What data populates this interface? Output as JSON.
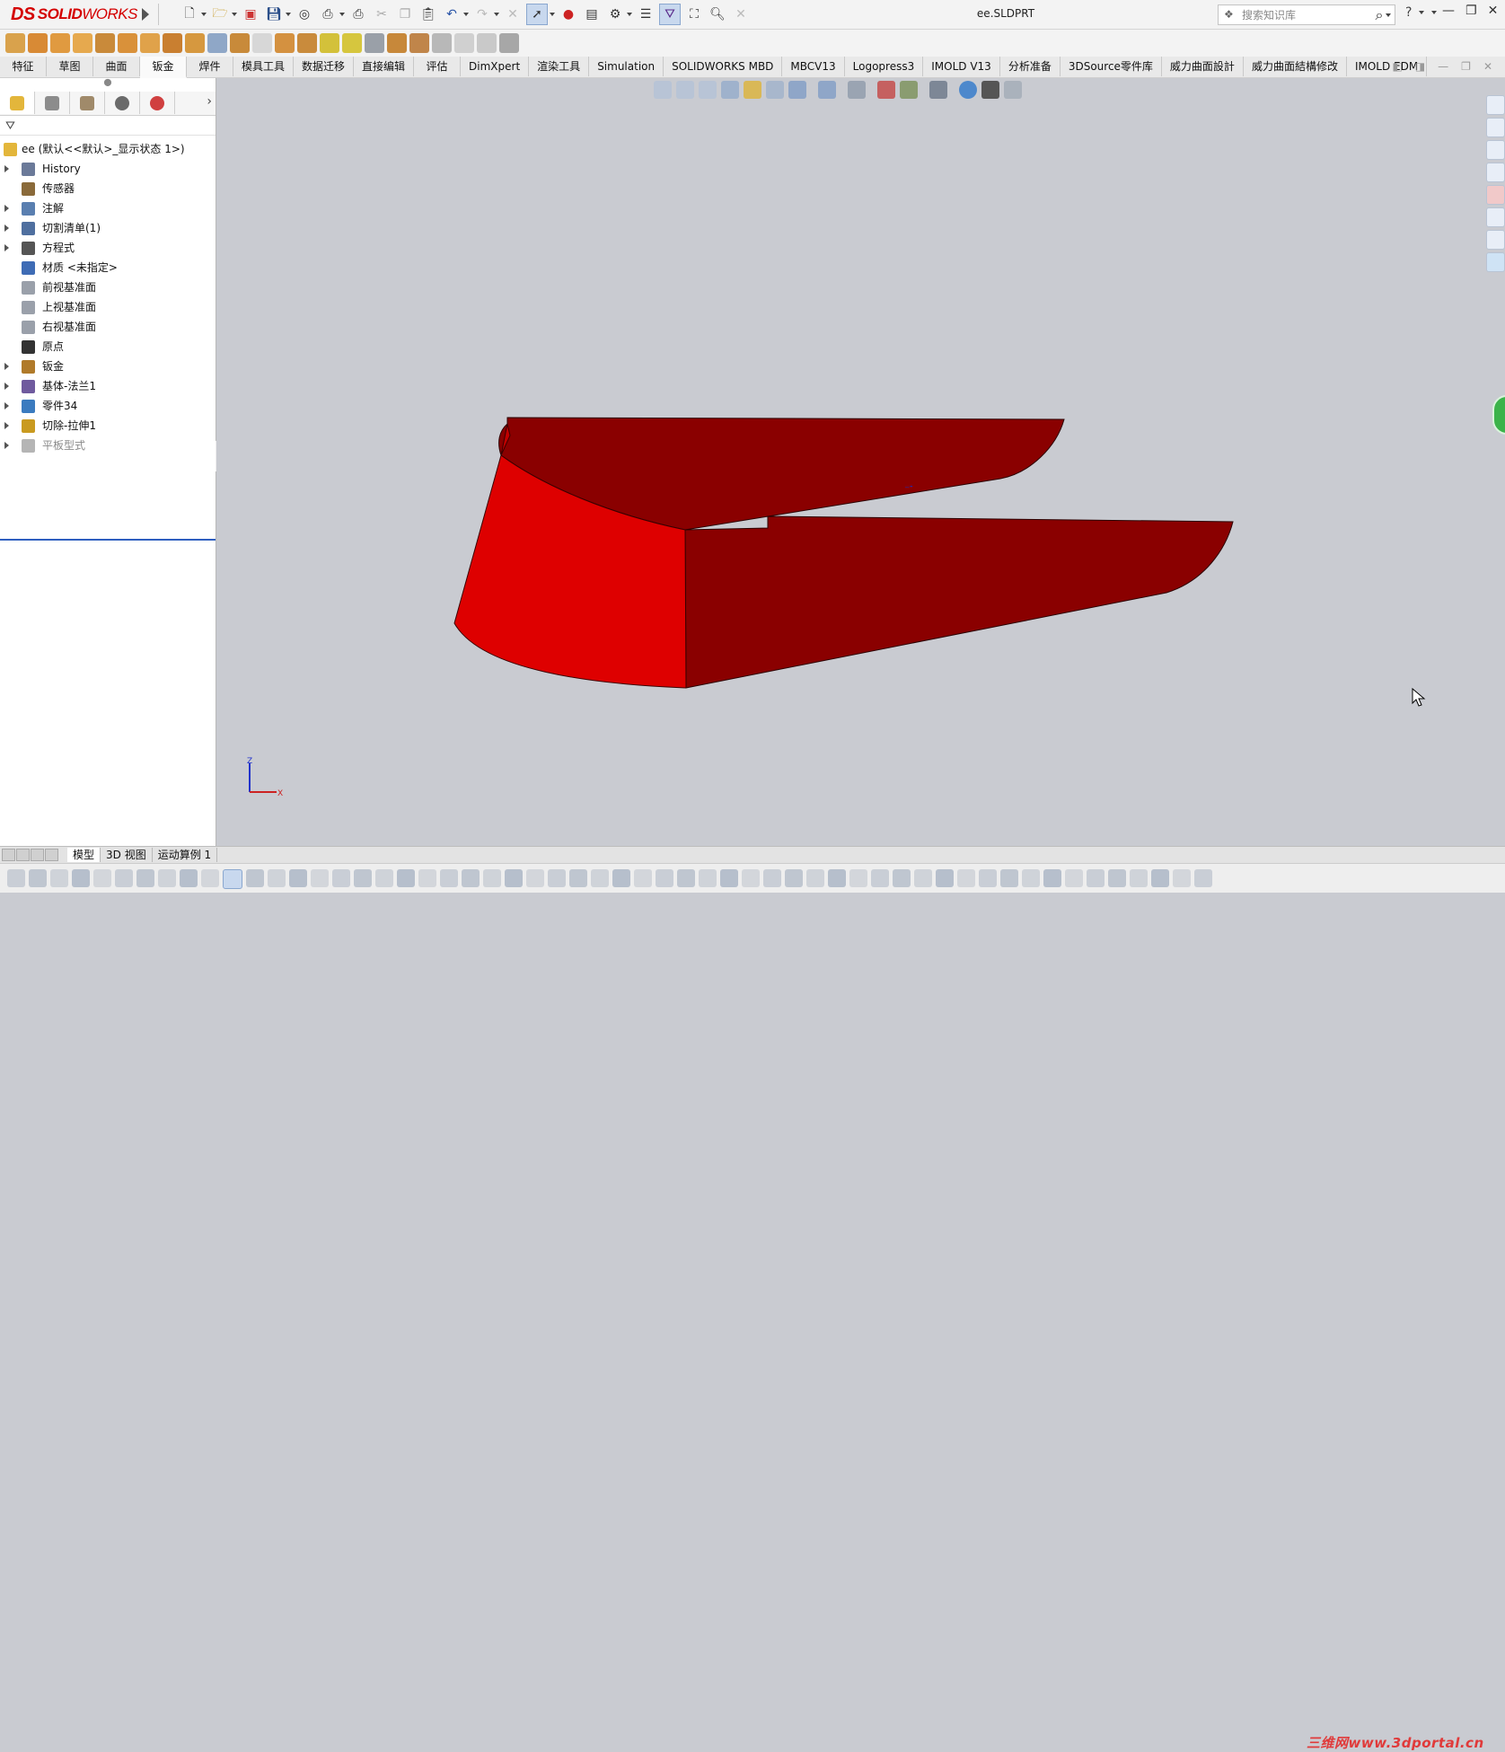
{
  "app": {
    "logo_text_1": "SOLID",
    "logo_text_2": "WORKS",
    "document_title": "ee.SLDPRT"
  },
  "search": {
    "placeholder": "搜索知识库"
  },
  "help": {
    "label": "?"
  },
  "tabs": [
    {
      "label": "特征",
      "active": false
    },
    {
      "label": "草图",
      "active": false
    },
    {
      "label": "曲面",
      "active": false
    },
    {
      "label": "钣金",
      "active": true
    },
    {
      "label": "焊件",
      "active": false
    },
    {
      "label": "模具工具",
      "active": false
    },
    {
      "label": "数据迁移",
      "active": false
    },
    {
      "label": "直接编辑",
      "active": false
    },
    {
      "label": "评估",
      "active": false
    },
    {
      "label": "DimXpert",
      "active": false
    },
    {
      "label": "渲染工具",
      "active": false
    },
    {
      "label": "Simulation",
      "active": false
    },
    {
      "label": "SOLIDWORKS MBD",
      "active": false
    },
    {
      "label": "MBCV13",
      "active": false
    },
    {
      "label": "Logopress3",
      "active": false
    },
    {
      "label": "IMOLD V13",
      "active": false
    },
    {
      "label": "分析准备",
      "active": false
    },
    {
      "label": "3DSource零件库",
      "active": false
    },
    {
      "label": "威力曲面設計",
      "active": false
    },
    {
      "label": "威力曲面結構修改",
      "active": false
    },
    {
      "label": "IMOLD EDM",
      "active": false
    }
  ],
  "tree": {
    "root": "ee  (默认<<默认>_显示状态 1>)",
    "items": [
      {
        "label": "History",
        "expandable": true,
        "icon": "history-icon",
        "color": "#6b7a99"
      },
      {
        "label": "传感器",
        "expandable": false,
        "icon": "sensor-icon",
        "color": "#8a6a3a"
      },
      {
        "label": "注解",
        "expandable": true,
        "icon": "annotation-icon",
        "color": "#5a7fb0"
      },
      {
        "label": "切割清单(1)",
        "expandable": true,
        "icon": "cutlist-icon",
        "color": "#4f6f9f"
      },
      {
        "label": "方程式",
        "expandable": true,
        "icon": "equation-icon",
        "color": "#555555"
      },
      {
        "label": "材质 <未指定>",
        "expandable": false,
        "icon": "material-icon",
        "color": "#3f6cb5"
      },
      {
        "label": "前视基准面",
        "expandable": false,
        "icon": "plane-icon",
        "color": "#9aa0aa"
      },
      {
        "label": "上视基准面",
        "expandable": false,
        "icon": "plane-icon",
        "color": "#9aa0aa"
      },
      {
        "label": "右视基准面",
        "expandable": false,
        "icon": "plane-icon",
        "color": "#9aa0aa"
      },
      {
        "label": "原点",
        "expandable": false,
        "icon": "origin-icon",
        "color": "#333333"
      },
      {
        "label": "钣金",
        "expandable": true,
        "icon": "sheetmetal-icon",
        "color": "#b07a2a"
      },
      {
        "label": "基体-法兰1",
        "expandable": true,
        "icon": "base-flange-icon",
        "color": "#6f5a9e"
      },
      {
        "label": "零件34",
        "expandable": true,
        "icon": "part-icon",
        "color": "#3b7bbf"
      },
      {
        "label": "切除-拉伸1",
        "expandable": true,
        "icon": "cut-extrude-icon",
        "color": "#c99a20"
      },
      {
        "label": "平板型式",
        "expandable": true,
        "icon": "flat-pattern-icon",
        "color": "#b5b5b5",
        "dim": true
      }
    ]
  },
  "bottom_tabs": [
    {
      "label": "模型",
      "active": true
    },
    {
      "label": "3D 视图",
      "active": false
    },
    {
      "label": "运动算例 1",
      "active": false
    }
  ],
  "colors": {
    "part_front": "#de0000",
    "part_side": "#8a0000",
    "viewport_bg": "#c9cbd1"
  },
  "watermark": "三维网www.3dportal.cn"
}
